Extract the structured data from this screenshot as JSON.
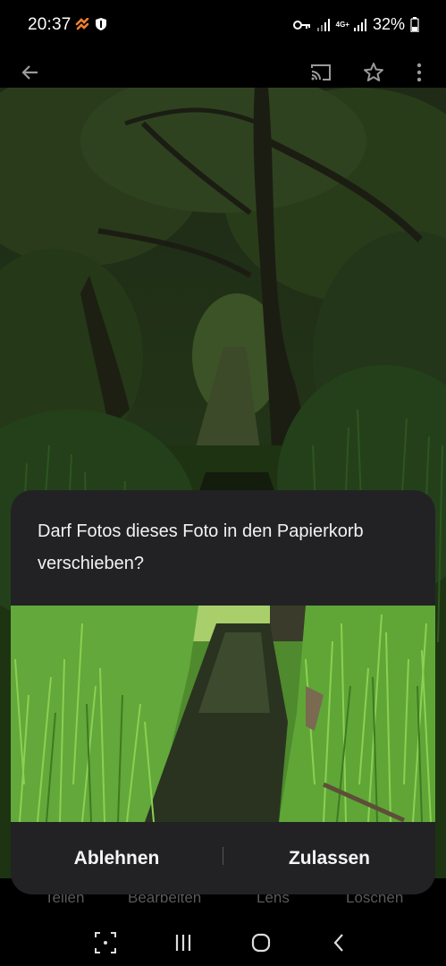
{
  "status_bar": {
    "time": "20:37",
    "battery": "32%",
    "network": "4G+",
    "icons": [
      "sync-icon",
      "shield-icon",
      "key-icon",
      "signal-icon",
      "signal-icon",
      "battery-icon"
    ]
  },
  "app_bar": {
    "icons": [
      "back-arrow-icon",
      "cast-icon",
      "star-icon",
      "more-vert-icon"
    ]
  },
  "toolbar": {
    "items": [
      {
        "label": "Teilen",
        "icon": "share-icon"
      },
      {
        "label": "Bearbeiten",
        "icon": "edit-icon"
      },
      {
        "label": "Lens",
        "icon": "lens-icon"
      },
      {
        "label": "Löschen",
        "icon": "delete-icon"
      }
    ]
  },
  "dialog": {
    "title": "Darf Fotos dieses Foto in den Papierkorb verschieben?",
    "deny_label": "Ablehnen",
    "allow_label": "Zulassen"
  },
  "nav_bar": {
    "icons": [
      "screenshot-icon",
      "recents-icon",
      "home-icon",
      "back-icon"
    ]
  },
  "colors": {
    "dialog_bg": "#222225",
    "background": "#000000",
    "toolbar_text": "#5a5a5a"
  }
}
